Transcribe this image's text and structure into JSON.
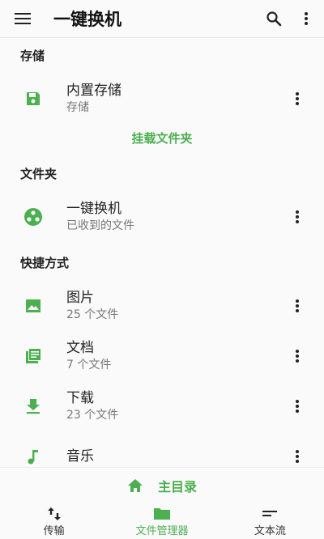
{
  "app": {
    "title": "一键换机"
  },
  "colors": {
    "accent": "#4caf50",
    "text": "#222222",
    "secondary": "#777777"
  },
  "sections": {
    "storage": {
      "header": "存储",
      "item": {
        "title": "内置存储",
        "subtitle": "存储",
        "icon": "floppy-disk-icon"
      },
      "mount_label": "挂载文件夹"
    },
    "folders": {
      "header": "文件夹",
      "item": {
        "title": "一键换机",
        "subtitle": "已收到的文件",
        "icon": "share-circle-icon"
      }
    },
    "shortcuts": {
      "header": "快捷方式",
      "items": [
        {
          "title": "图片",
          "subtitle": "25 个文件",
          "icon": "image-icon"
        },
        {
          "title": "文档",
          "subtitle": "7 个文件",
          "icon": "documents-icon"
        },
        {
          "title": "下载",
          "subtitle": "23 个文件",
          "icon": "download-icon"
        },
        {
          "title": "音乐",
          "subtitle": "",
          "icon": "music-icon"
        }
      ]
    }
  },
  "bottom": {
    "home_label": "主目录",
    "nav": [
      {
        "label": "传输",
        "icon": "transfer-icon"
      },
      {
        "label": "文件管理器",
        "icon": "folder-icon",
        "active": true
      },
      {
        "label": "文本流",
        "icon": "text-stream-icon"
      }
    ]
  }
}
